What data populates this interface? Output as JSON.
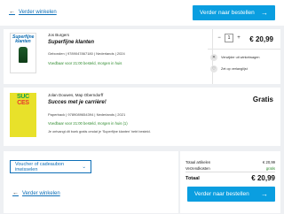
{
  "nav": {
    "back_label": "Verder winkelen",
    "checkout_label": "Verder naar bestellen"
  },
  "items": [
    {
      "author": "Jos Burgers",
      "title": "Superfijne klanten",
      "meta": "Gebonden | 9789047867180 | Nederlands | 2024",
      "stock": "Voedbaar voor 21:00 besteld, morgen in huis",
      "cover_title": "Superfijne klanten",
      "quantity": "1",
      "qty_minus": "−",
      "qty_plus": "+",
      "price": "€ 20,99",
      "actions": [
        "Verwijder uit winkelwagen",
        "Zet op verlanglijst"
      ]
    },
    {
      "author": "Jolan Douwes, Map Oberndorff",
      "title": "Succes met je carrière!",
      "meta": "Paperback | 9789089654394 | Nederlands | 2021",
      "stock": "Voedbaar voor 21:00 besteld, morgen in huis (1)",
      "note": "Je ontvangt dit boek gratis omdat je 'Superfijne klanten' hebt besteld.",
      "cover_lines": [
        "SUC",
        "CES"
      ],
      "price": "Gratis"
    }
  ],
  "voucher": {
    "label": "Voucher of cadeaubon inwisselen"
  },
  "totals": {
    "articles_label": "Totaal artikelen",
    "articles_value": "€ 20,99",
    "shipping_label": "Verzendkosten",
    "shipping_value": "gratis",
    "total_label": "Totaal",
    "total_value": "€ 20,99"
  },
  "colors": {
    "primary": "#0a9ee0",
    "link": "#0e6fb7",
    "stock": "#2e8b2e"
  }
}
